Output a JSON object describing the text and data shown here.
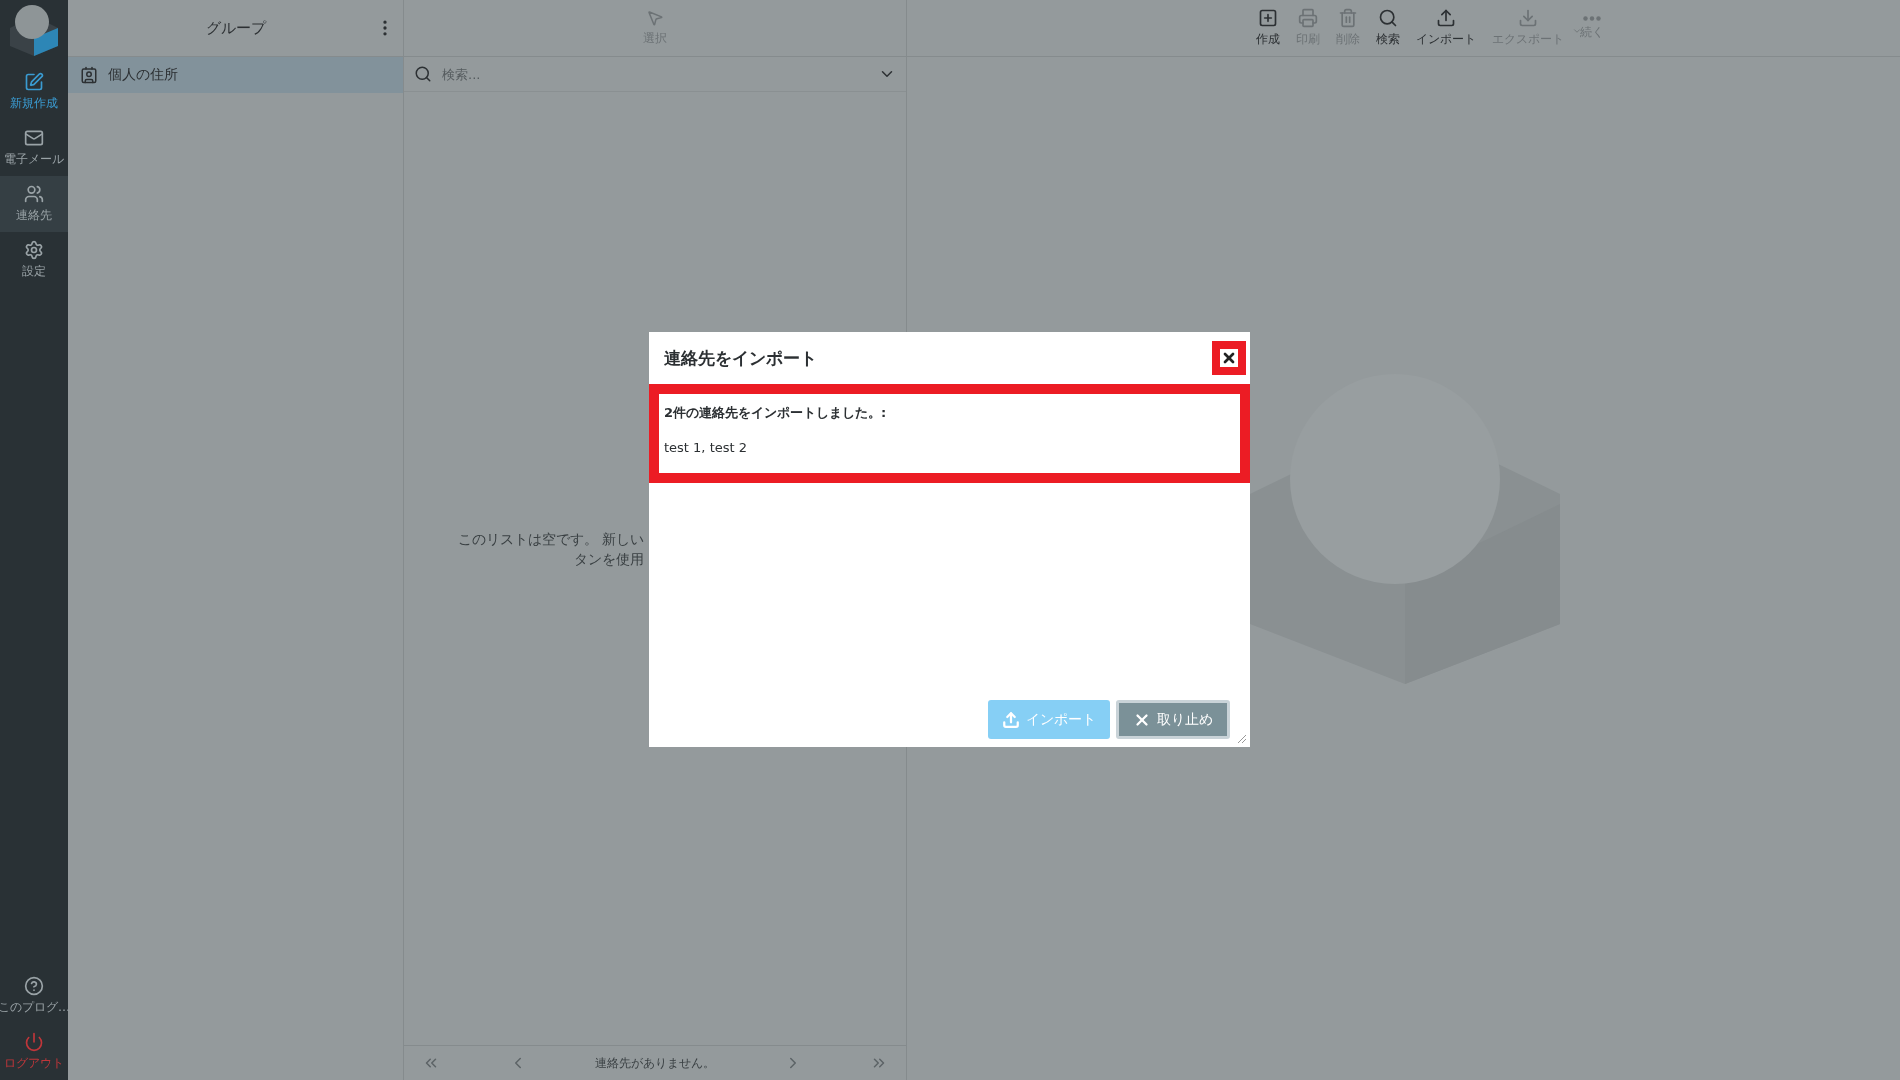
{
  "sidebar": {
    "items": [
      {
        "kind": "compose",
        "label": "新規作成",
        "selected": false
      },
      {
        "kind": "mail",
        "label": "電子メール",
        "selected": false
      },
      {
        "kind": "contacts",
        "label": "連絡先",
        "selected": true
      },
      {
        "kind": "settings",
        "label": "設定",
        "selected": false
      }
    ],
    "bottom_items": [
      {
        "kind": "about",
        "label": "このプログ…"
      },
      {
        "kind": "logout",
        "label": "ログアウト"
      }
    ]
  },
  "groups_panel": {
    "title": "グループ",
    "items": [
      {
        "label": "個人の住所",
        "selected": true
      }
    ]
  },
  "list_panel": {
    "select_button": {
      "label": "選択",
      "disabled": true
    },
    "search": {
      "placeholder": "検索..."
    },
    "empty_message": [
      "このリストは空です。 新しい",
      "タンを使用"
    ],
    "pager_status": "連絡先がありません。"
  },
  "toolbar": [
    {
      "kind": "create",
      "label": "作成",
      "disabled": false
    },
    {
      "kind": "print",
      "label": "印刷",
      "disabled": true
    },
    {
      "kind": "delete",
      "label": "削除",
      "disabled": true
    },
    {
      "kind": "search",
      "label": "検索",
      "disabled": false
    },
    {
      "kind": "import",
      "label": "インポート",
      "disabled": false
    },
    {
      "kind": "export",
      "label": "エクスポート",
      "disabled": true
    },
    {
      "kind": "more",
      "label": "続く",
      "disabled": true
    }
  ],
  "dialog": {
    "title": "連絡先をインポート",
    "message": "2件の連絡先をインポートしました。:",
    "names": "test 1, test 2",
    "buttons": [
      {
        "kind": "import",
        "label": "インポート",
        "disabled": true
      },
      {
        "kind": "cancel",
        "label": "取り止め",
        "disabled": false
      }
    ]
  }
}
